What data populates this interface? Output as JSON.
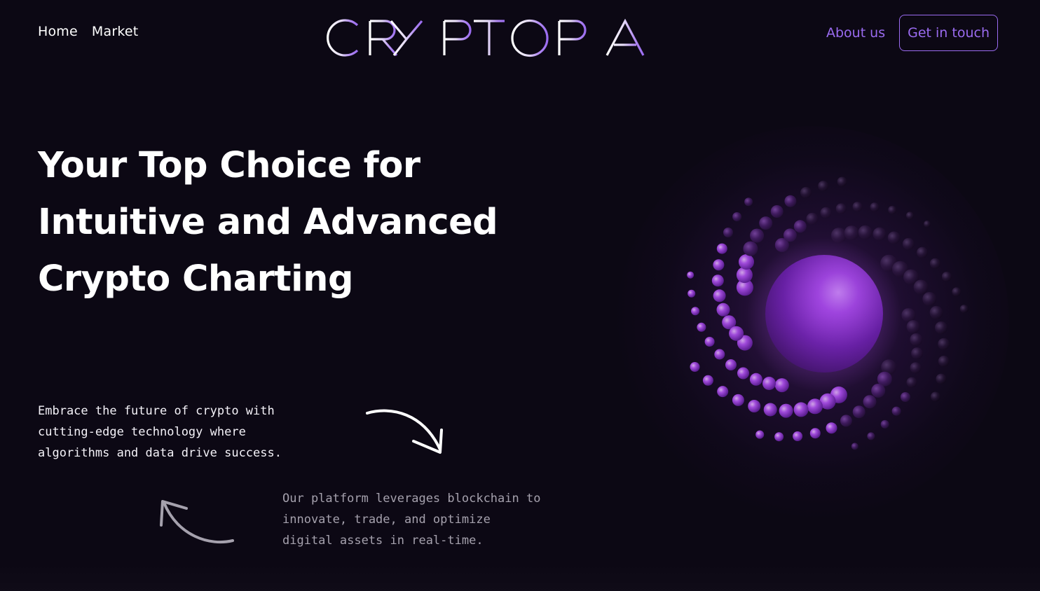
{
  "nav": {
    "home": "Home",
    "market": "Market",
    "about": "About us",
    "contact": "Get in touch"
  },
  "brand": {
    "logo_text": "CRYPTOPIA",
    "accent_color": "#9a6bf0",
    "background_color": "#0c0814"
  },
  "hero": {
    "title_lines": [
      "Your Top Choice for",
      "Intuitive and Advanced",
      "Crypto Charting"
    ],
    "text_one_lines": [
      "Embrace the future of crypto with",
      "cutting-edge technology where",
      "algorithms and data drive success."
    ],
    "text_two_lines": [
      "Our platform leverages blockchain to",
      "innovate, trade, and optimize",
      "digital assets in real-time."
    ]
  },
  "icons": {
    "arrow_one": "curved-arrow-down-right-icon",
    "arrow_two": "curved-arrow-up-left-icon",
    "illustration": "purple-sphere-orb"
  }
}
